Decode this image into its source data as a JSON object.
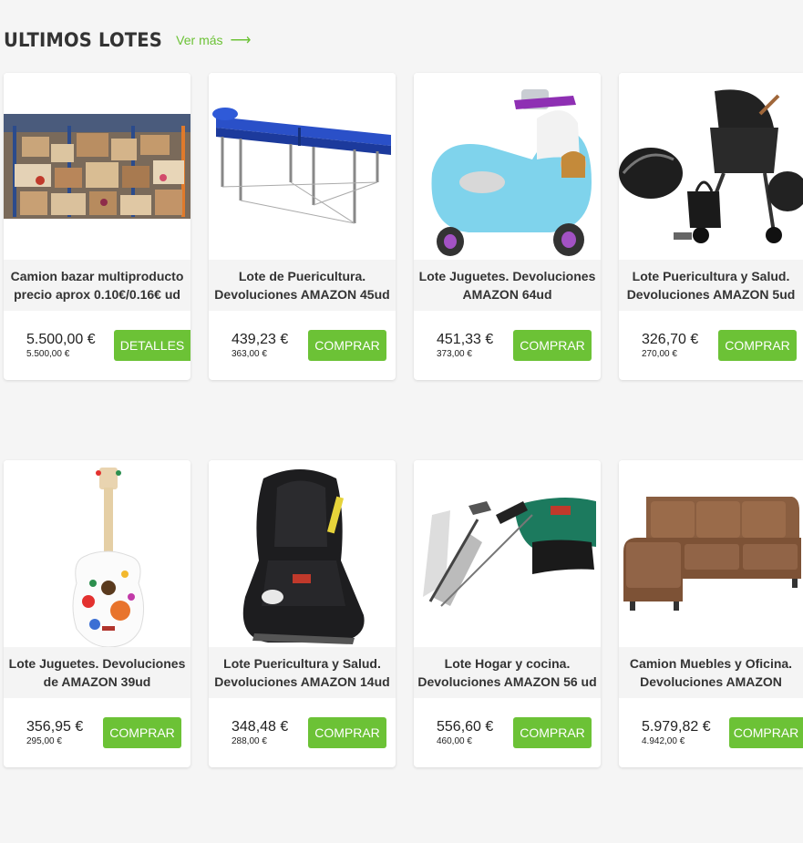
{
  "section": {
    "title": "ULTIMOS LOTES",
    "ver_mas": "Ver más",
    "arrow": "⟶"
  },
  "products": [
    {
      "name": "Camion bazar multiproducto precio aprox 0.10€/0.16€ ud",
      "price": "5.500,00 €",
      "price_net": "5.500,00 €",
      "button": "DETALLES",
      "image": "warehouse-pallets-image"
    },
    {
      "name": "Lote de Puericultura. Devoluciones AMAZON 45ud",
      "price": "439,23 €",
      "price_net": "363,00 €",
      "button": "COMPRAR",
      "image": "massage-table-image"
    },
    {
      "name": "Lote Juguetes. Devoluciones AMAZON 64ud",
      "price": "451,33 €",
      "price_net": "373,00 €",
      "button": "COMPRAR",
      "image": "kids-scooter-image"
    },
    {
      "name": "Lote Puericultura y Salud. Devoluciones AMAZON 5ud",
      "price": "326,70 €",
      "price_net": "270,00 €",
      "button": "COMPRAR",
      "image": "stroller-set-image"
    },
    {
      "name": "Lote Juguetes. Devoluciones de AMAZON 39ud",
      "price": "356,95 €",
      "price_net": "295,00 €",
      "button": "COMPRAR",
      "image": "toy-guitar-image"
    },
    {
      "name": "Lote Puericultura y Salud. Devoluciones AMAZON 14ud",
      "price": "348,48 €",
      "price_net": "288,00 €",
      "button": "COMPRAR",
      "image": "car-seat-image"
    },
    {
      "name": "Lote Hogar y cocina. Devoluciones AMAZON 56 ud",
      "price": "556,60 €",
      "price_net": "460,00 €",
      "button": "COMPRAR",
      "image": "pruning-saw-image"
    },
    {
      "name": "Camion Muebles y Oficina. Devoluciones AMAZON",
      "price": "5.979,82 €",
      "price_net": "4.942,00 €",
      "button": "COMPRAR",
      "image": "sofa-image"
    }
  ],
  "colors": {
    "accent": "#6cc236",
    "background": "#f5f5f5",
    "card": "#ffffff",
    "name_band": "#f4f4f4"
  }
}
